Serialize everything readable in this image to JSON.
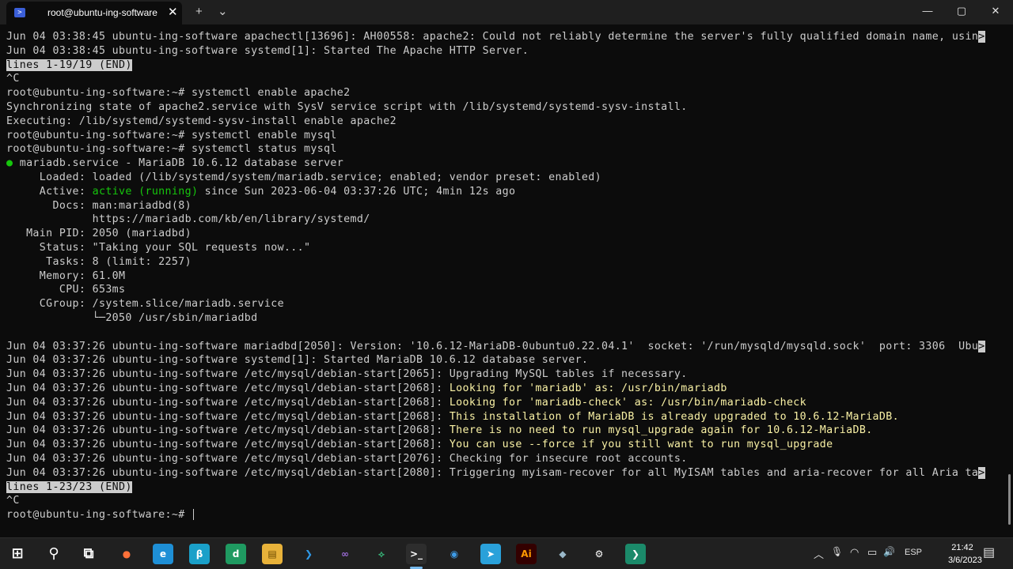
{
  "window": {
    "tab_title": "root@ubuntu-ing-software",
    "tab_close": "✕",
    "new_tab": "+",
    "dropdown": "⌄",
    "minimize": "—",
    "maximize": "▢",
    "close": "✕"
  },
  "terminal": {
    "lines": [
      [
        {
          "t": "Jun 04 03:38:45 ubuntu-ing-software apachectl[13696]: AH00558: apache2: Could not reliably determine the server's fully qualified domain name, usin"
        },
        {
          "t": ">",
          "c": "inv"
        }
      ],
      [
        {
          "t": "Jun 04 03:38:45 ubuntu-ing-software systemd[1]: Started The Apache HTTP Server."
        }
      ],
      [
        {
          "t": "lines 1-19/19 (END)",
          "c": "inv"
        }
      ],
      [
        {
          "t": "^C"
        }
      ],
      [
        {
          "t": "root@ubuntu-ing-software:~# systemctl enable apache2"
        }
      ],
      [
        {
          "t": "Synchronizing state of apache2.service with SysV service script with /lib/systemd/systemd-sysv-install."
        }
      ],
      [
        {
          "t": "Executing: /lib/systemd/systemd-sysv-install enable apache2"
        }
      ],
      [
        {
          "t": "root@ubuntu-ing-software:~# systemctl enable mysql"
        }
      ],
      [
        {
          "t": "root@ubuntu-ing-software:~# systemctl status mysql"
        }
      ],
      [
        {
          "t": "●",
          "c": "green"
        },
        {
          "t": " mariadb.service - MariaDB 10.6.12 database server"
        }
      ],
      [
        {
          "t": "     Loaded: loaded (/lib/systemd/system/mariadb.service; enabled; vendor preset: enabled)"
        }
      ],
      [
        {
          "t": "     Active: "
        },
        {
          "t": "active (running)",
          "c": "green"
        },
        {
          "t": " since Sun 2023-06-04 03:37:26 UTC; 4min 12s ago"
        }
      ],
      [
        {
          "t": "       Docs: man:mariadbd(8)"
        }
      ],
      [
        {
          "t": "             https://mariadb.com/kb/en/library/systemd/"
        }
      ],
      [
        {
          "t": "   Main PID: 2050 (mariadbd)"
        }
      ],
      [
        {
          "t": "     Status: \"Taking your SQL requests now...\""
        }
      ],
      [
        {
          "t": "      Tasks: 8 (limit: 2257)"
        }
      ],
      [
        {
          "t": "     Memory: 61.0M"
        }
      ],
      [
        {
          "t": "        CPU: 653ms"
        }
      ],
      [
        {
          "t": "     CGroup: /system.slice/mariadb.service"
        }
      ],
      [
        {
          "t": "             └─2050 /usr/sbin/mariadbd"
        }
      ],
      [
        {
          "t": ""
        }
      ],
      [
        {
          "t": "Jun 04 03:37:26 ubuntu-ing-software mariadbd[2050]: Version: '10.6.12-MariaDB-0ubuntu0.22.04.1'  socket: '/run/mysqld/mysqld.sock'  port: 3306  Ubu"
        },
        {
          "t": ">",
          "c": "inv"
        }
      ],
      [
        {
          "t": "Jun 04 03:37:26 ubuntu-ing-software systemd[1]: Started MariaDB 10.6.12 database server."
        }
      ],
      [
        {
          "t": "Jun 04 03:37:26 ubuntu-ing-software /etc/mysql/debian-start[2065]: Upgrading MySQL tables if necessary."
        }
      ],
      [
        {
          "t": "Jun 04 03:37:26 ubuntu-ing-software /etc/mysql/debian-start[2068]: "
        },
        {
          "t": "Looking for 'mariadb' as: /usr/bin/mariadb",
          "c": "yellow"
        }
      ],
      [
        {
          "t": "Jun 04 03:37:26 ubuntu-ing-software /etc/mysql/debian-start[2068]: "
        },
        {
          "t": "Looking for 'mariadb-check' as: /usr/bin/mariadb-check",
          "c": "yellow"
        }
      ],
      [
        {
          "t": "Jun 04 03:37:26 ubuntu-ing-software /etc/mysql/debian-start[2068]: "
        },
        {
          "t": "This installation of MariaDB is already upgraded to 10.6.12-MariaDB.",
          "c": "yellow"
        }
      ],
      [
        {
          "t": "Jun 04 03:37:26 ubuntu-ing-software /etc/mysql/debian-start[2068]: "
        },
        {
          "t": "There is no need to run mysql_upgrade again for 10.6.12-MariaDB.",
          "c": "yellow"
        }
      ],
      [
        {
          "t": "Jun 04 03:37:26 ubuntu-ing-software /etc/mysql/debian-start[2068]: "
        },
        {
          "t": "You can use --force if you still want to run mysql_upgrade",
          "c": "yellow"
        }
      ],
      [
        {
          "t": "Jun 04 03:37:26 ubuntu-ing-software /etc/mysql/debian-start[2076]: Checking for insecure root accounts."
        }
      ],
      [
        {
          "t": "Jun 04 03:37:26 ubuntu-ing-software /etc/mysql/debian-start[2080]: Triggering myisam-recover for all MyISAM tables and aria-recover for all Aria ta"
        },
        {
          "t": ">",
          "c": "inv"
        }
      ],
      [
        {
          "t": "lines 1-23/23 (END)",
          "c": "inv"
        }
      ],
      [
        {
          "t": "^C"
        }
      ],
      [
        {
          "t": "root@ubuntu-ing-software:~# "
        },
        {
          "t": "",
          "c": "cursor"
        }
      ]
    ]
  },
  "taskbar": {
    "apps": [
      {
        "name": "start-button",
        "label": "⊞",
        "bg": "transparent",
        "fg": "#ffffff"
      },
      {
        "name": "search-icon",
        "label": "⚲",
        "bg": "transparent",
        "fg": "#ffffff"
      },
      {
        "name": "task-view-icon",
        "label": "⧉",
        "bg": "transparent",
        "fg": "#ffffff"
      },
      {
        "name": "firefox-icon",
        "label": "●",
        "bg": "transparent",
        "fg": "#ff7139"
      },
      {
        "name": "edge-icon",
        "label": "e",
        "bg": "#1e8fd6",
        "fg": "#ffffff"
      },
      {
        "name": "edge-beta-icon",
        "label": "β",
        "bg": "#1aa0c9",
        "fg": "#ffffff"
      },
      {
        "name": "edge-dev-icon",
        "label": "d",
        "bg": "#1f9a61",
        "fg": "#ffffff"
      },
      {
        "name": "file-explorer-icon",
        "label": "▤",
        "bg": "#e8b23a",
        "fg": "#6b4a00"
      },
      {
        "name": "vscode-icon",
        "label": "❯",
        "bg": "transparent",
        "fg": "#2f9ae8"
      },
      {
        "name": "visual-studio-icon",
        "label": "∞",
        "bg": "transparent",
        "fg": "#9c6bd6"
      },
      {
        "name": "vscode-insiders-icon",
        "label": "⟡",
        "bg": "transparent",
        "fg": "#37b679"
      },
      {
        "name": "terminal-icon",
        "label": ">_",
        "bg": "#2d2d2d",
        "fg": "#ffffff"
      },
      {
        "name": "browser-app-icon",
        "label": "◉",
        "bg": "transparent",
        "fg": "#3e9ce8"
      },
      {
        "name": "telegram-icon",
        "label": "➤",
        "bg": "#2aa1da",
        "fg": "#ffffff"
      },
      {
        "name": "illustrator-icon",
        "label": "Ai",
        "bg": "#330000",
        "fg": "#ff9a00"
      },
      {
        "name": "app-icon",
        "label": "◆",
        "bg": "transparent",
        "fg": "#9ab8c9"
      },
      {
        "name": "settings-icon",
        "label": "⚙",
        "bg": "transparent",
        "fg": "#ffffff"
      },
      {
        "name": "powershell-app-icon",
        "label": "❯",
        "bg": "#1b8a6a",
        "fg": "#ffffff"
      }
    ],
    "tray": {
      "chevron": "︿",
      "mic": "🎙",
      "wifi": "◠",
      "battery": "▭",
      "volume": "🔊",
      "language": "ESP",
      "time": "21:42",
      "date": "3/6/2023",
      "notifications": "▤"
    }
  }
}
